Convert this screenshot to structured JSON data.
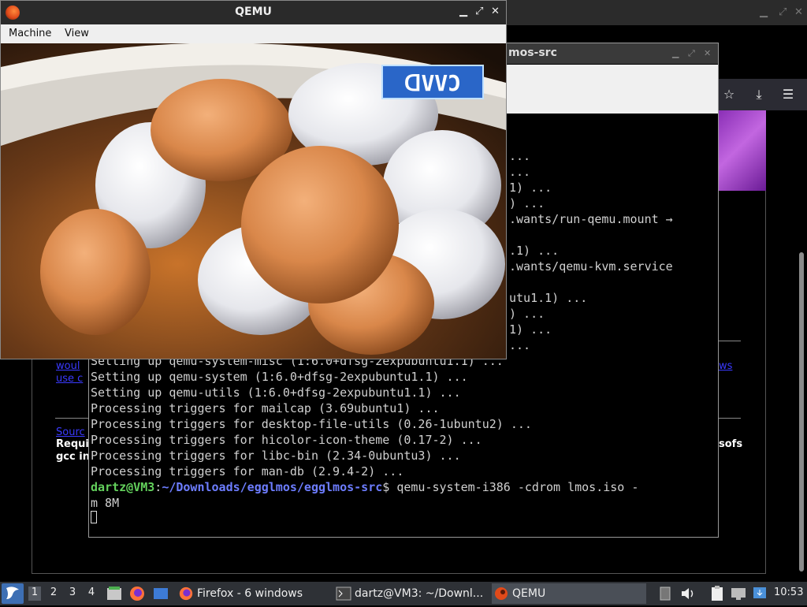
{
  "qemu": {
    "title": "QEMU",
    "menu": [
      "Machine",
      "View"
    ],
    "guest_logo_text": "ᗡVVƆ"
  },
  "terminal": {
    "title": "mos-src",
    "lines_visible": [
      "...",
      "...",
      "1) ...",
      ") ...",
      ".wants/run-qemu.mount →",
      "",
      ".1) ...",
      ".wants/qemu-kvm.service",
      "",
      "utu1.1) ...",
      ") ...",
      "1) ...",
      "..."
    ],
    "lines": [
      "Setting up qemu-system-misc (1:6.0+dfsg-2expubuntu1.1) ...",
      "Setting up qemu-system (1:6.0+dfsg-2expubuntu1.1) ...",
      "Setting up qemu-utils (1:6.0+dfsg-2expubuntu1.1) ...",
      "Processing triggers for mailcap (3.69ubuntu1) ...",
      "Processing triggers for desktop-file-utils (0.26-1ubuntu2) ...",
      "Processing triggers for hicolor-icon-theme (0.17-2) ...",
      "Processing triggers for libc-bin (2.34-0ubuntu3) ...",
      "Processing triggers for man-db (2.9.4-2) ..."
    ],
    "prompt_user": "dartz@VM3",
    "prompt_sep": ":",
    "prompt_path": "~/Downloads/egglmos/egglmos-src",
    "prompt_end": "$ ",
    "command": "qemu-system-i386 -cdrom lmos.iso -",
    "command_cont": "m 8M"
  },
  "firefox": {
    "page_link_1": "woul",
    "page_link_2": "use c",
    "page_link_3": "Sourc",
    "page_link_right": "ws",
    "page_bold_1": "Requi",
    "page_bold_2": "gcc in",
    "page_bold_right": "sofs"
  },
  "taskbar": {
    "workspaces": [
      "1",
      "2",
      "3",
      "4"
    ],
    "tasks": [
      {
        "label": "Firefox - 6 windows"
      },
      {
        "label": "dartz@VM3: ~/Downl..."
      },
      {
        "label": "QEMU"
      }
    ],
    "clock": "10:53"
  },
  "colors": {
    "terminal_bg": "#000000",
    "prompt_user": "#63d05c",
    "prompt_path": "#6d7dff",
    "taskbar_bg": "#2e3136",
    "start_button": "#3d6fb4"
  }
}
